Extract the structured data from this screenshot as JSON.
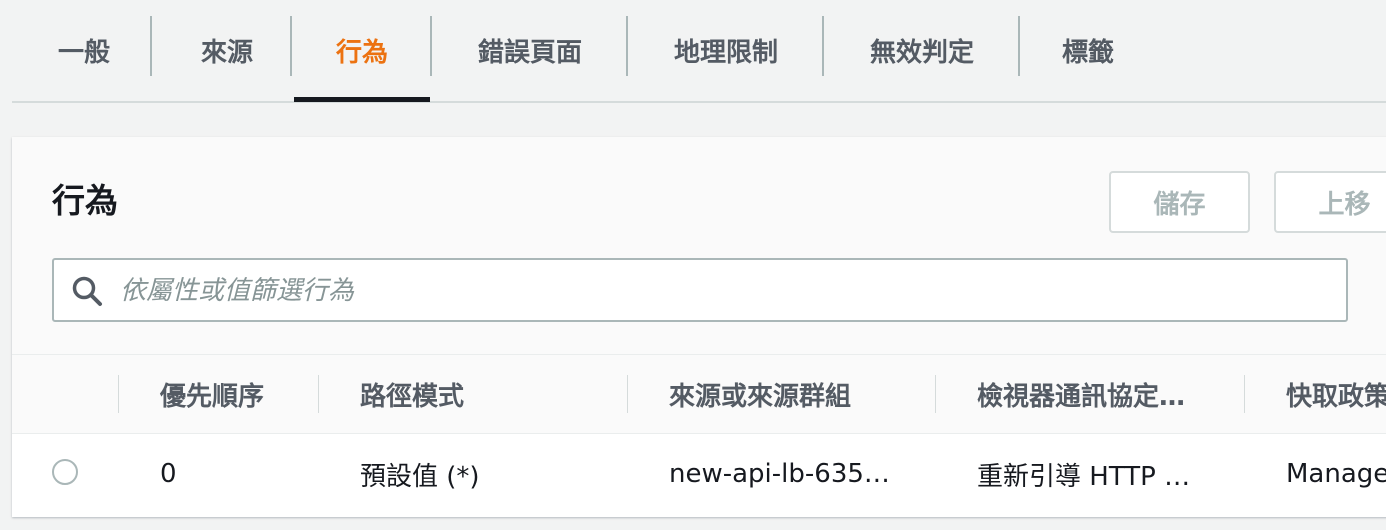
{
  "tabs": [
    {
      "label": "一般"
    },
    {
      "label": "來源"
    },
    {
      "label": "行為"
    },
    {
      "label": "錯誤頁面"
    },
    {
      "label": "地理限制"
    },
    {
      "label": "無效判定"
    },
    {
      "label": "標籤"
    }
  ],
  "active_tab": "行為",
  "panel": {
    "title": "行為",
    "save_label": "儲存",
    "move_up_label": "上移",
    "search_placeholder": "依屬性或值篩選行為"
  },
  "table": {
    "columns": [
      "優先順序",
      "路徑模式",
      "來源或來源群組",
      "檢視器通訊協定…",
      "快取政策"
    ],
    "rows": [
      {
        "priority": "0",
        "path_pattern": "預設值 (*)",
        "origin": "new-api-lb-635…",
        "viewer_protocol": "重新引導 HTTP …",
        "cache_policy": "Managed"
      }
    ]
  },
  "colors": {
    "accent": "#ec7211",
    "text": "#16191f",
    "muted": "#545b64",
    "border": "#d5dbdb"
  },
  "icons": [
    "search-icon",
    "radio-button"
  ]
}
